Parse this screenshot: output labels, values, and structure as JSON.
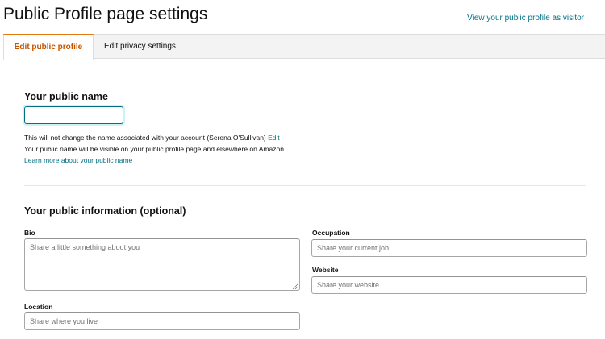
{
  "header": {
    "title": "Public Profile page settings",
    "visitor_link": "View your public profile as visitor"
  },
  "tabs": [
    {
      "label": "Edit public profile",
      "active": true
    },
    {
      "label": "Edit privacy settings",
      "active": false
    }
  ],
  "public_name": {
    "heading": "Your public name",
    "value": "",
    "note_line1": "This will not change the name associated with your account (Serena O'Sullivan)",
    "edit_link": "Edit",
    "note_line2": "Your public name will be visible on your public profile page and elsewhere on Amazon.",
    "learn_more_link": "Learn more about your public name"
  },
  "public_info": {
    "heading": "Your public information (optional)",
    "bio": {
      "label": "Bio",
      "placeholder": "Share a little something about you"
    },
    "occupation": {
      "label": "Occupation",
      "placeholder": "Share your current job"
    },
    "website": {
      "label": "Website",
      "placeholder": "Share your website"
    },
    "location": {
      "label": "Location",
      "placeholder": "Share where you live"
    }
  },
  "colors": {
    "link": "#007185",
    "active_tab_text": "#c45500",
    "active_tab_accent": "#e47911",
    "tab_bar_bg": "#f3f3f3"
  }
}
